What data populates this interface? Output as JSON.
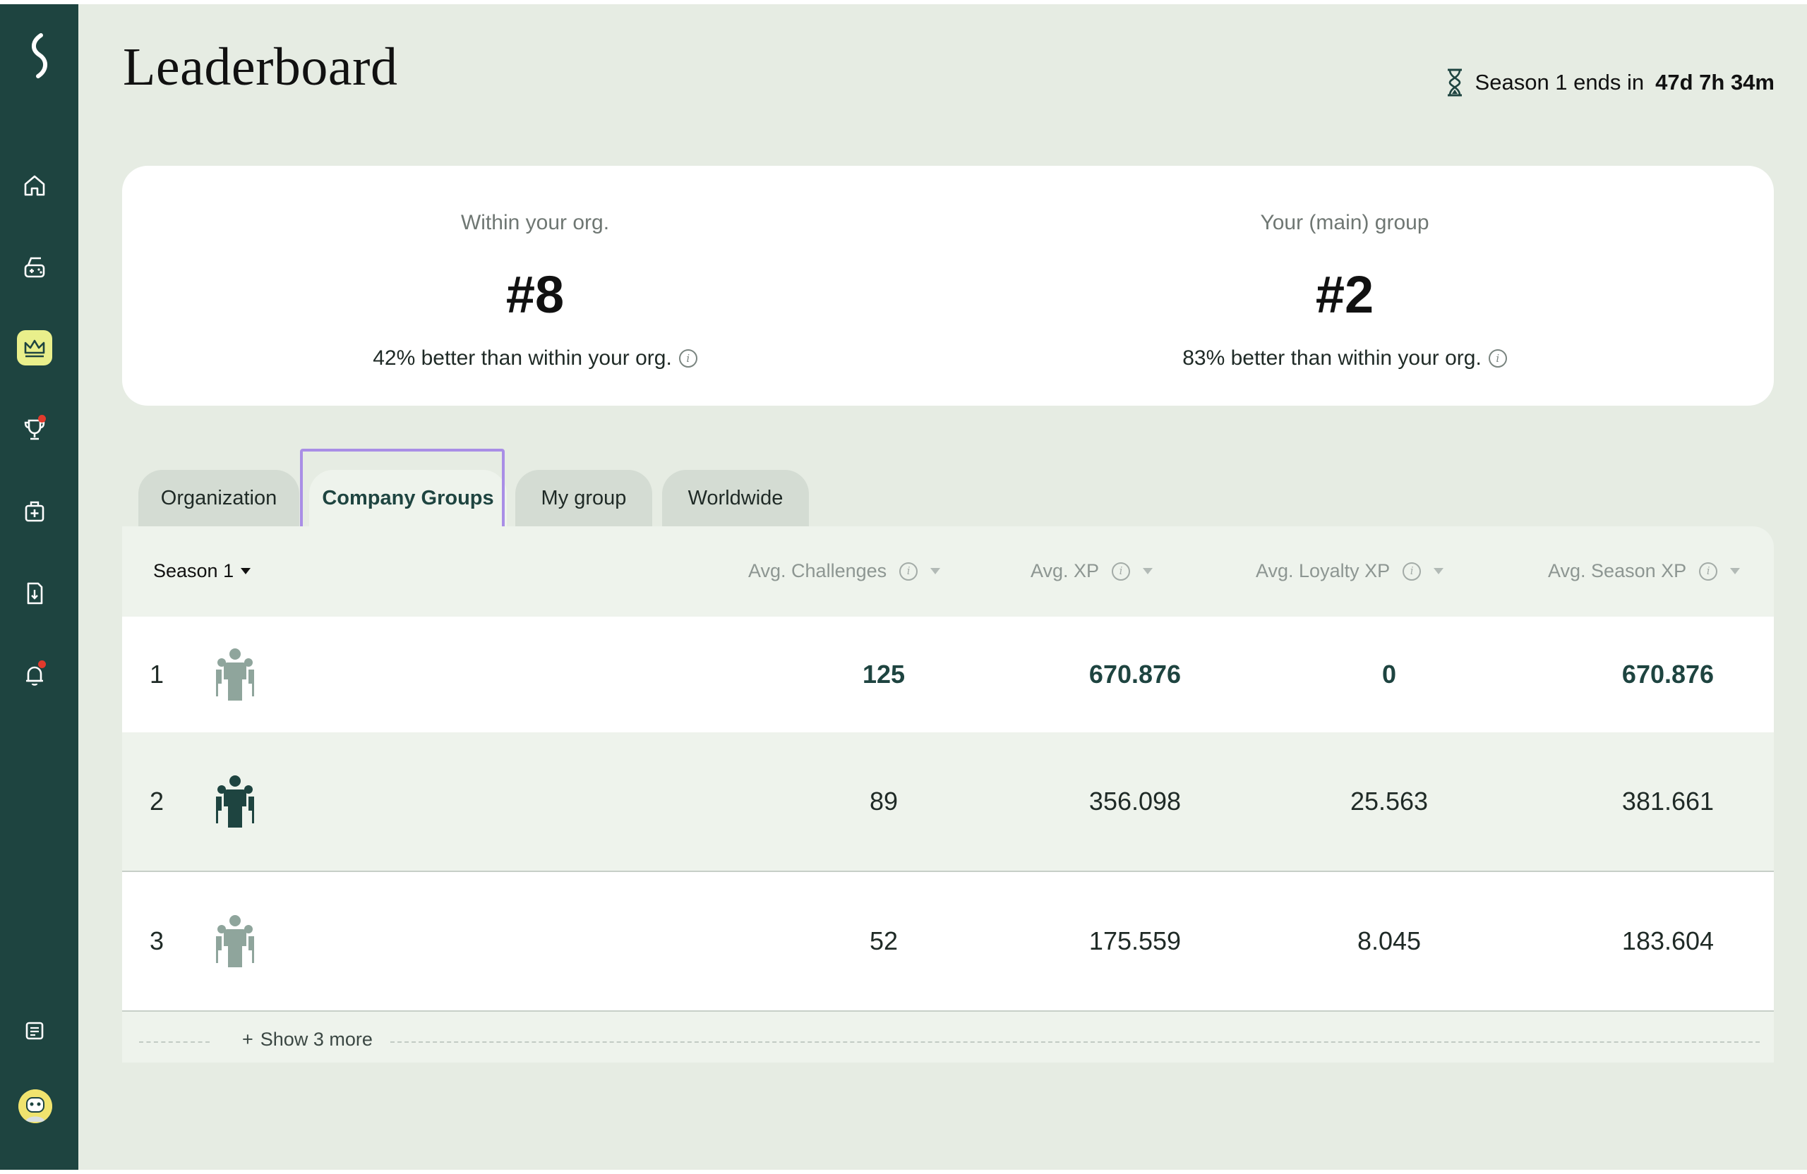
{
  "header": {
    "title": "Leaderboard",
    "season_end_prefix": "Season 1 ends in",
    "season_end_value": "47d 7h 34m"
  },
  "stats": [
    {
      "label": "Within your org.",
      "rank": "#8",
      "desc": "42% better than within your org."
    },
    {
      "label": "Your (main) group",
      "rank": "#2",
      "desc": "83% better than within your org."
    }
  ],
  "tabs": [
    {
      "label": "Organization",
      "active": false
    },
    {
      "label": "Company Groups",
      "active": true
    },
    {
      "label": "My group",
      "active": false
    },
    {
      "label": "Worldwide",
      "active": false
    }
  ],
  "table": {
    "season_select": "Season 1",
    "columns": [
      "Avg. Challenges",
      "Avg. XP",
      "Avg. Loyalty XP",
      "Avg. Season XP"
    ],
    "rows": [
      {
        "pos": "1",
        "challenges": "125",
        "xp": "670.876",
        "loyalty": "0",
        "season": "670.876"
      },
      {
        "pos": "2",
        "challenges": "89",
        "xp": "356.098",
        "loyalty": "25.563",
        "season": "381.661"
      },
      {
        "pos": "3",
        "challenges": "52",
        "xp": "175.559",
        "loyalty": "8.045",
        "season": "183.604"
      }
    ],
    "show_more": "Show 3 more"
  },
  "sidebar": {
    "items": [
      "home-icon",
      "gamepad-icon",
      "crown-icon",
      "trophy-icon",
      "medkit-icon",
      "document-icon",
      "bell-icon",
      "chat-icon"
    ],
    "active": "crown-icon"
  },
  "colors": {
    "sidebar_bg": "#1e4440",
    "page_bg": "#e6ece3",
    "accent": "#e9ef8b",
    "focus": "#a98ee6",
    "notification": "#e23a2c"
  }
}
